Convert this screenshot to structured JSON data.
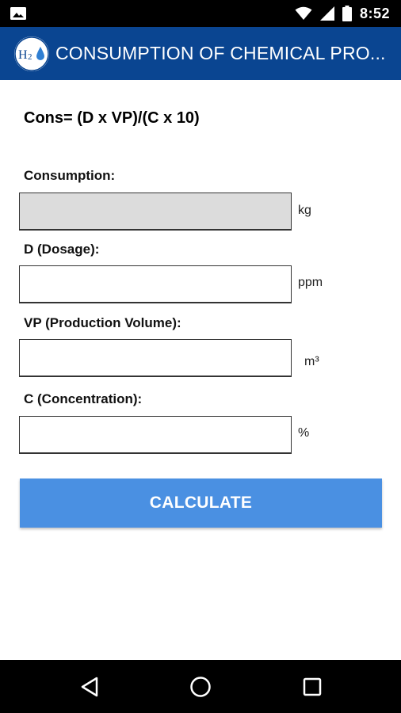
{
  "status_bar": {
    "time": "8:52",
    "icons": [
      "image-icon",
      "wifi-icon",
      "signal-icon",
      "battery-icon"
    ]
  },
  "app_bar": {
    "logo_text": "H2",
    "title": "CONSUMPTION OF CHEMICAL PRO..."
  },
  "formula": "Cons= (D x VP)/(C x 10)",
  "fields": {
    "consumption": {
      "label": "Consumption:",
      "value": "",
      "unit": "kg"
    },
    "dosage": {
      "label": "D (Dosage):",
      "value": "",
      "unit": "ppm"
    },
    "production_volume": {
      "label": "VP (Production Volume):",
      "value": "",
      "unit": "m³"
    },
    "concentration": {
      "label": "C (Concentration):",
      "value": "",
      "unit": "%"
    }
  },
  "calculate_button": {
    "label": "CALCULATE",
    "color": "#4a90e2"
  },
  "nav_bar": {
    "icons": [
      "back-icon",
      "home-icon",
      "recents-icon"
    ]
  },
  "colors": {
    "app_bar": "#0a4591",
    "readonly_field": "#dcdcdc"
  }
}
